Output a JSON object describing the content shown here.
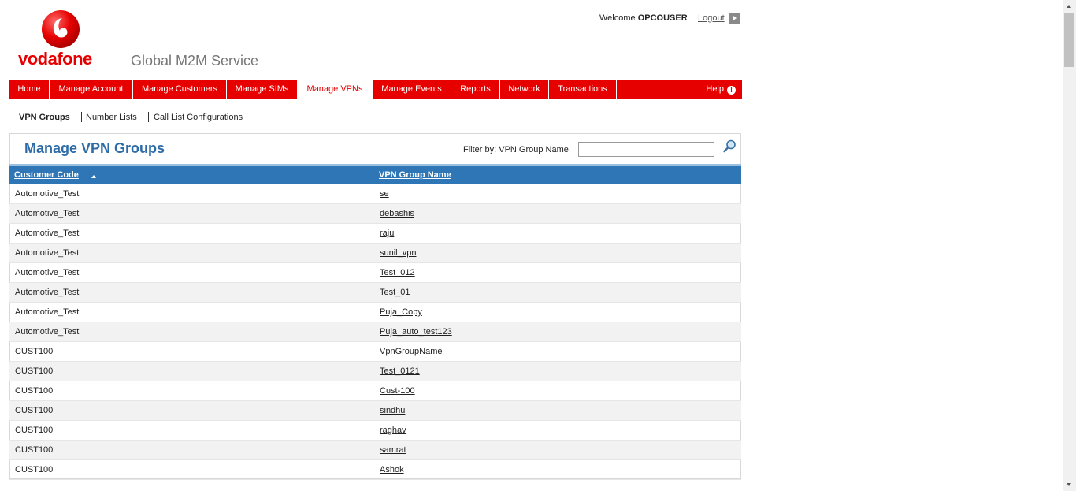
{
  "brand": {
    "name": "vodafone",
    "service": "Global M2M Service",
    "accent": "#e60000"
  },
  "header": {
    "welcome_prefix": "Welcome",
    "username": "OPCOUSER",
    "logout_label": "Logout"
  },
  "nav": {
    "items": [
      {
        "label": "Home"
      },
      {
        "label": "Manage Account"
      },
      {
        "label": "Manage Customers"
      },
      {
        "label": "Manage SIMs"
      },
      {
        "label": "Manage VPNs",
        "active": true
      },
      {
        "label": "Manage Events"
      },
      {
        "label": "Reports"
      },
      {
        "label": "Network"
      },
      {
        "label": "Transactions"
      }
    ],
    "help_label": "Help"
  },
  "subnav": {
    "items": [
      {
        "label": "VPN Groups",
        "active": true
      },
      {
        "label": "Number Lists"
      },
      {
        "label": "Call List Configurations"
      }
    ]
  },
  "panel": {
    "title": "Manage VPN Groups",
    "filter_label": "Filter by: VPN Group Name",
    "filter_value": ""
  },
  "table": {
    "columns": [
      "Customer Code",
      "VPN Group Name"
    ],
    "sort": {
      "column": "Customer Code",
      "direction": "ascending"
    },
    "header_color": "#2e76b6",
    "rows": [
      {
        "code": "Automotive_Test",
        "name": "se"
      },
      {
        "code": "Automotive_Test",
        "name": "debashis"
      },
      {
        "code": "Automotive_Test",
        "name": "raju"
      },
      {
        "code": "Automotive_Test",
        "name": "sunil_vpn"
      },
      {
        "code": "Automotive_Test",
        "name": "Test_012"
      },
      {
        "code": "Automotive_Test",
        "name": "Test_01"
      },
      {
        "code": "Automotive_Test",
        "name": "Puja_Copy"
      },
      {
        "code": "Automotive_Test",
        "name": "Puja_auto_test123"
      },
      {
        "code": "CUST100",
        "name": "VpnGroupName"
      },
      {
        "code": "CUST100",
        "name": "Test_0121"
      },
      {
        "code": "CUST100",
        "name": "Cust-100"
      },
      {
        "code": "CUST100",
        "name": "sindhu"
      },
      {
        "code": "CUST100",
        "name": "raghav"
      },
      {
        "code": "CUST100",
        "name": "samrat"
      },
      {
        "code": "CUST100",
        "name": "Ashok"
      }
    ]
  }
}
